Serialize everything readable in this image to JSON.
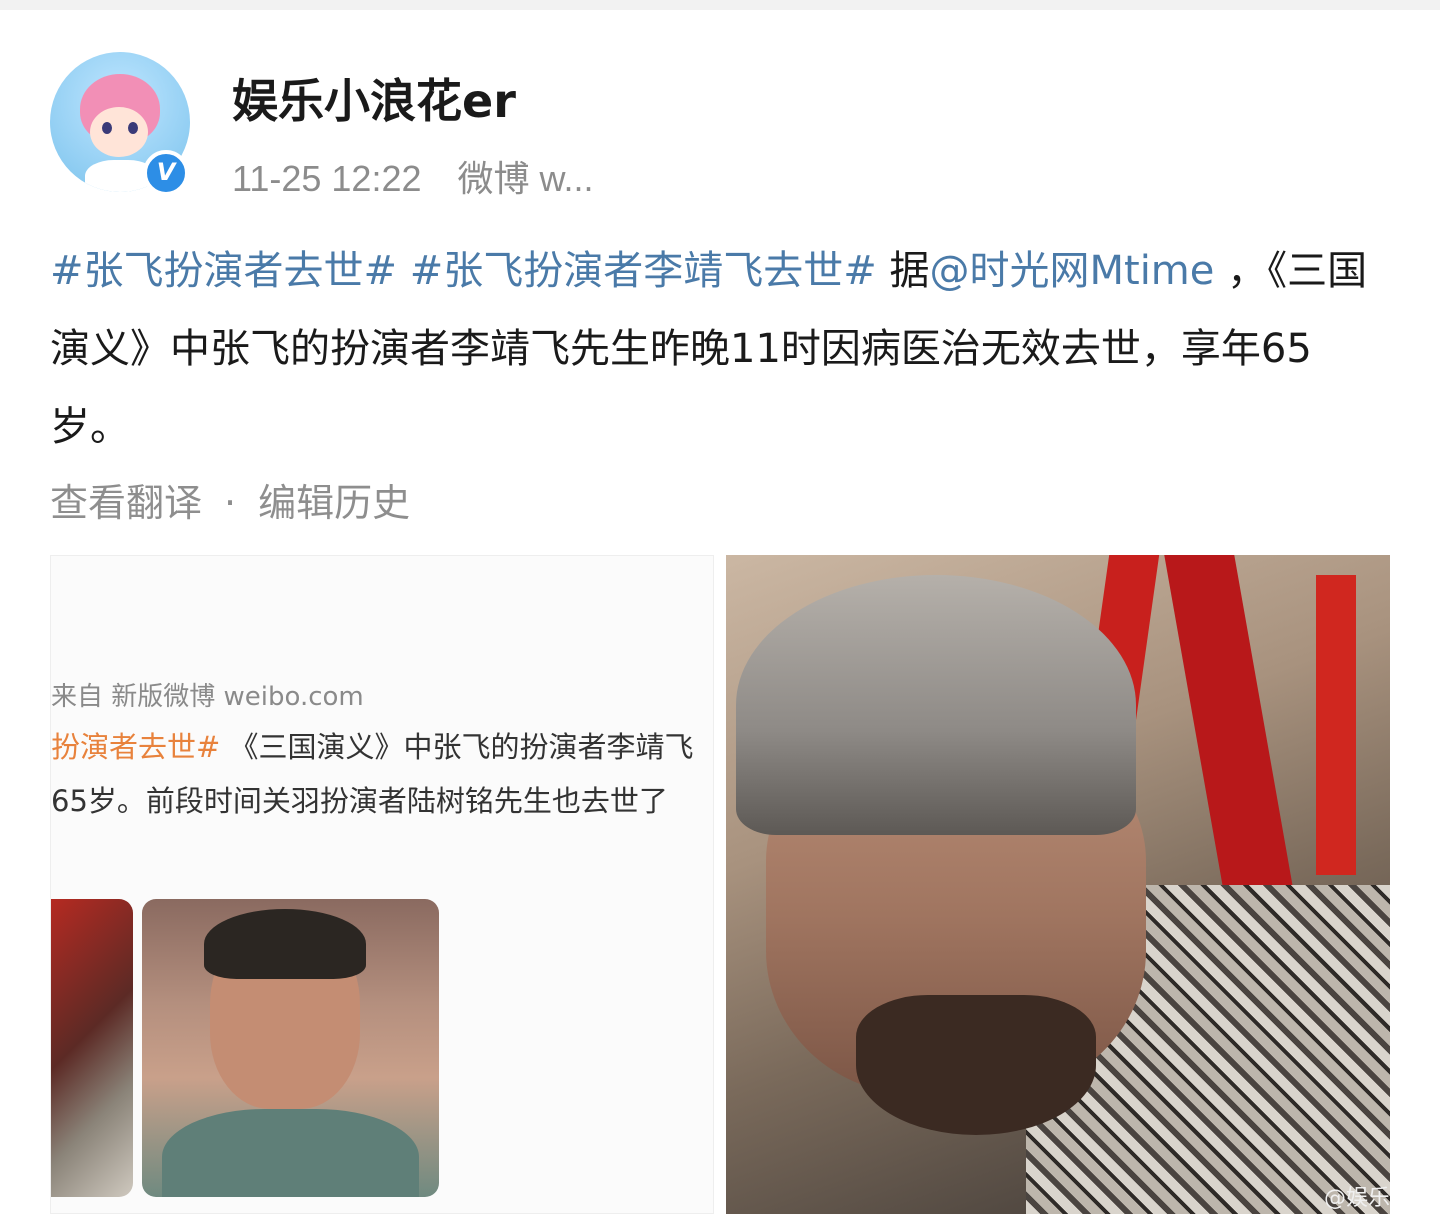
{
  "post": {
    "username": "娱乐小浪花er",
    "timestamp": "11-25 12:22",
    "source": "微博 w...",
    "verified_badge": "V",
    "content": {
      "hashtag1": "#张飞扮演者去世#",
      "hashtag2": "#张飞扮演者李靖飞去世#",
      "text_pre_mention": " 据",
      "mention": "@时光网Mtime",
      "text_main": " ，《三国演义》中张飞的扮演者李靖飞先生昨晚11时因病医治无效去世，享年65岁。"
    },
    "actions": {
      "translate": "查看翻译",
      "separator": "·",
      "edit_history": "编辑历史"
    },
    "images": {
      "image1": {
        "caption_source": "来自 新版微博 weibo.com",
        "caption_hashtag": "扮演者去世#",
        "caption_line2_rest": " 《三国演义》中张飞的扮演者李靖飞",
        "caption_line3": "65岁。前段时间关羽扮演者陆树铭先生也去世了"
      },
      "image2": {
        "watermark": "@娱乐"
      }
    }
  },
  "colors": {
    "link": "#4a7aa8",
    "text": "#1a1a1a",
    "meta": "#8c8c8c",
    "verified": "#2d8ee6"
  }
}
